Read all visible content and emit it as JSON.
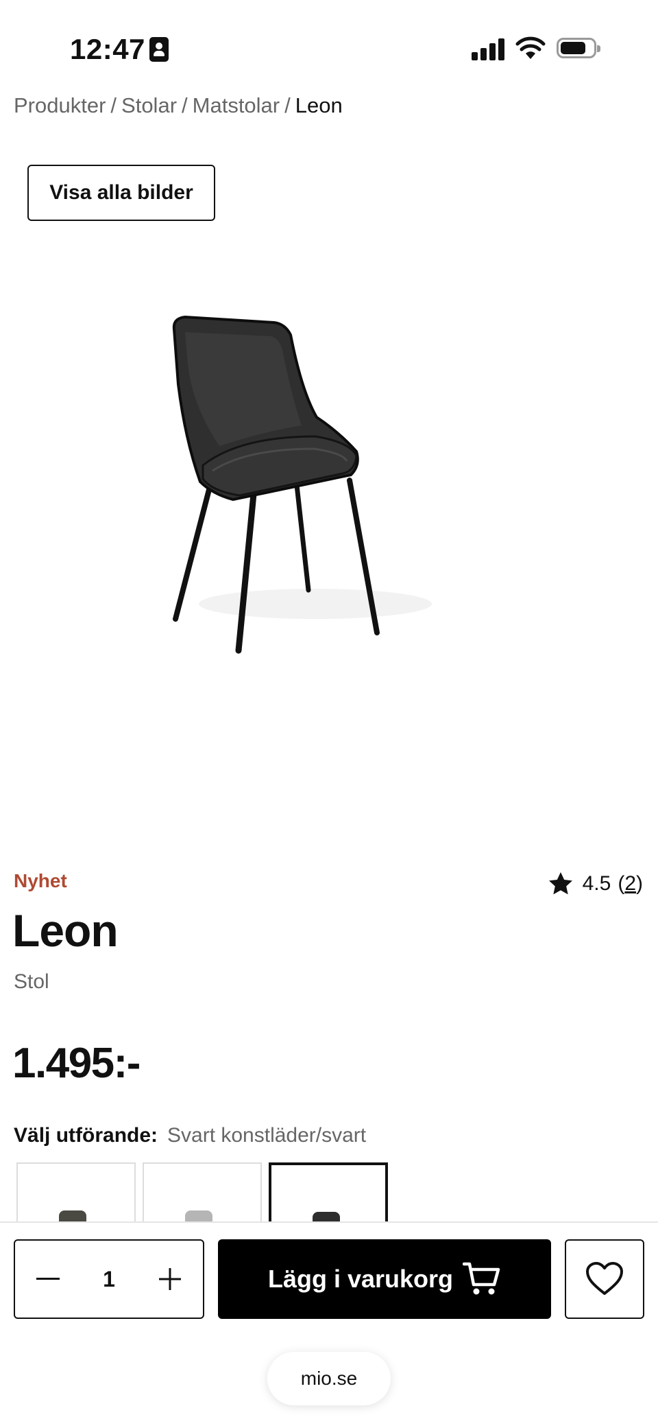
{
  "status_bar": {
    "time": "12:47"
  },
  "breadcrumb": [
    "Produkter",
    "Stolar",
    "Matstolar",
    "Leon"
  ],
  "gallery": {
    "view_all_label": "Visa alla bilder",
    "image_alt": "Leon"
  },
  "product": {
    "badge": "Nyhet",
    "name": "Leon",
    "type": "Stol",
    "price": "1.495:-",
    "rating": {
      "score": "4.5",
      "count": "2"
    },
    "variant": {
      "label": "Välj utförande:",
      "value": "Svart konstläder/svart",
      "selected_index": 2
    }
  },
  "cart_bar": {
    "quantity": "1",
    "decrement_icon": "minus-icon",
    "increment_icon": "plus-icon",
    "add_label": "Lägg i varukorg",
    "cart_icon": "cart-icon",
    "favorite_icon": "heart-icon"
  },
  "browser": {
    "url": "mio.se"
  },
  "colors": {
    "accent_new": "#b04a32",
    "button": "#000000"
  }
}
